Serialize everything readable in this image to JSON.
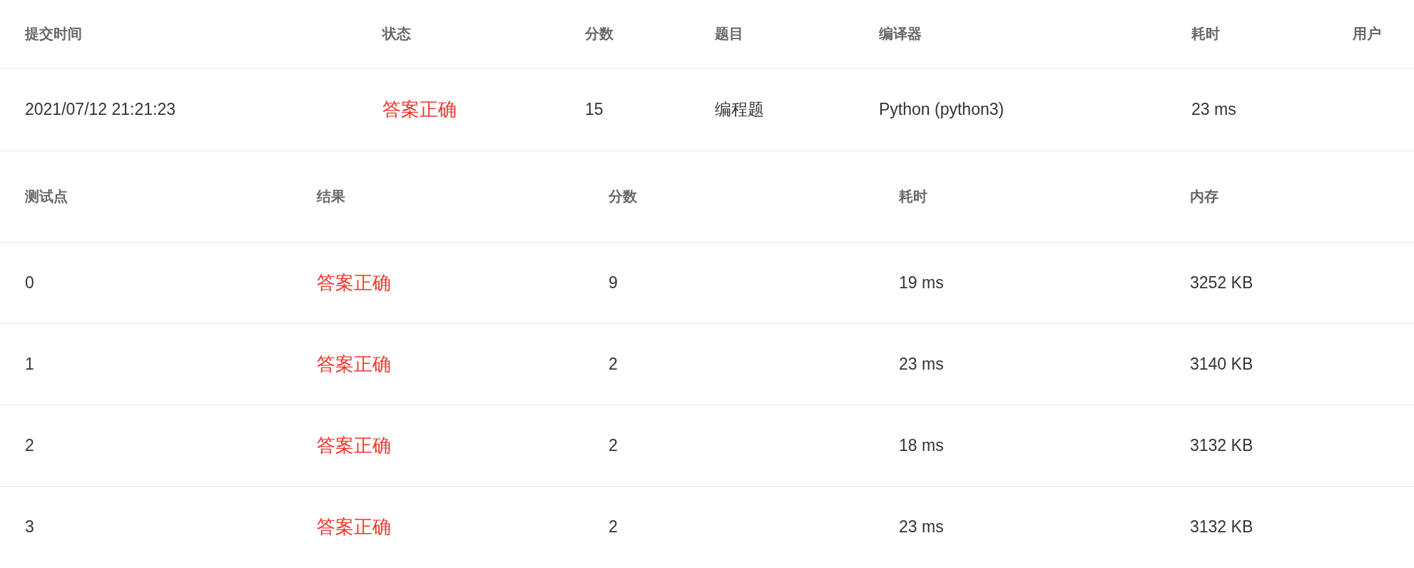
{
  "submission": {
    "columns": [
      "提交时间",
      "状态",
      "分数",
      "题目",
      "编译器",
      "耗时",
      "用户"
    ],
    "row": {
      "time": "2021/07/12 21:21:23",
      "status": {
        "text": "答案正确",
        "kind": "accepted"
      },
      "score": "15",
      "problem": "编程题",
      "compiler": "Python (python3)",
      "duration": "23 ms"
    }
  },
  "testcases": {
    "columns": [
      "测试点",
      "结果",
      "分数",
      "耗时",
      "内存"
    ],
    "rows": [
      {
        "case": "0",
        "result": {
          "text": "答案正确",
          "kind": "accepted"
        },
        "score": "9",
        "duration": "19 ms",
        "memory": "3252 KB"
      },
      {
        "case": "1",
        "result": {
          "text": "答案正确",
          "kind": "accepted"
        },
        "score": "2",
        "duration": "23 ms",
        "memory": "3140 KB"
      },
      {
        "case": "2",
        "result": {
          "text": "答案正确",
          "kind": "accepted"
        },
        "score": "2",
        "duration": "18 ms",
        "memory": "3132 KB"
      },
      {
        "case": "3",
        "result": {
          "text": "答案正确",
          "kind": "accepted"
        },
        "score": "2",
        "duration": "23 ms",
        "memory": "3132 KB"
      }
    ]
  }
}
